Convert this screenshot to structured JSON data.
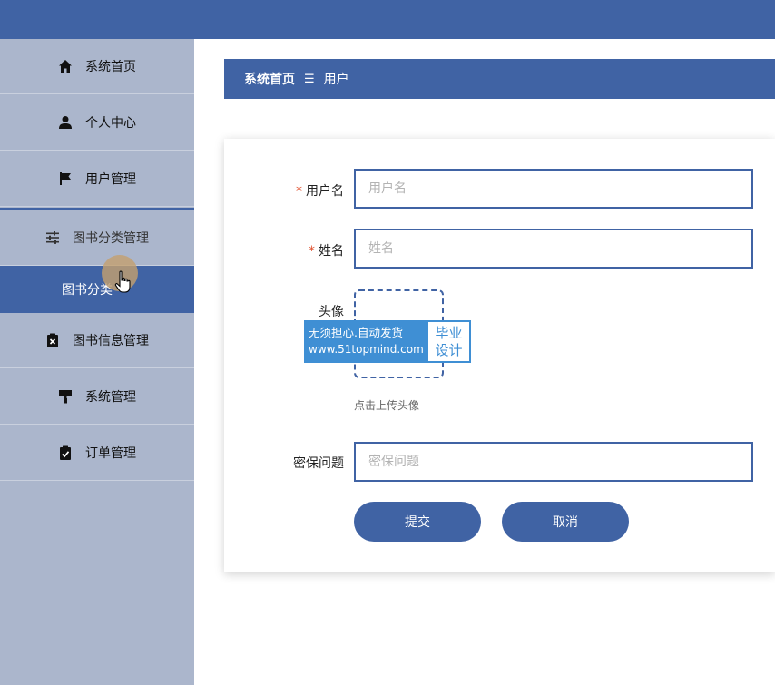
{
  "sidebar": {
    "items": [
      {
        "label": "系统首页",
        "icon": "home-icon"
      },
      {
        "label": "个人中心",
        "icon": "person-icon"
      },
      {
        "label": "用户管理",
        "icon": "flag-icon"
      },
      {
        "label": "图书分类管理",
        "icon": "sliders-icon"
      },
      {
        "label": "图书信息管理",
        "icon": "clipboard-x-icon"
      },
      {
        "label": "系统管理",
        "icon": "paint-roller-icon"
      },
      {
        "label": "订单管理",
        "icon": "clipboard-check-icon"
      }
    ],
    "sub_item": {
      "label": "图书分类"
    }
  },
  "breadcrumb": {
    "home": "系统首页",
    "separator": "☰",
    "current": "用户"
  },
  "form": {
    "username": {
      "label": "用户名",
      "placeholder": "用户名",
      "required": true
    },
    "name": {
      "label": "姓名",
      "placeholder": "姓名",
      "required": true
    },
    "avatar": {
      "label": "头像",
      "tip": "点击上传头像"
    },
    "security_question": {
      "label": "密保问题",
      "placeholder": "密保问题"
    },
    "submit_label": "提交",
    "cancel_label": "取消"
  },
  "watermark": {
    "line1": "无须担心.自动发货",
    "line2": "www.51topmind.com",
    "right_line1": "毕业",
    "right_line2": "设计"
  },
  "colors": {
    "primary": "#4063a4",
    "sidebar_bg": "#abb6cc",
    "required": "#e0502e",
    "watermark": "#3f8fd4"
  }
}
